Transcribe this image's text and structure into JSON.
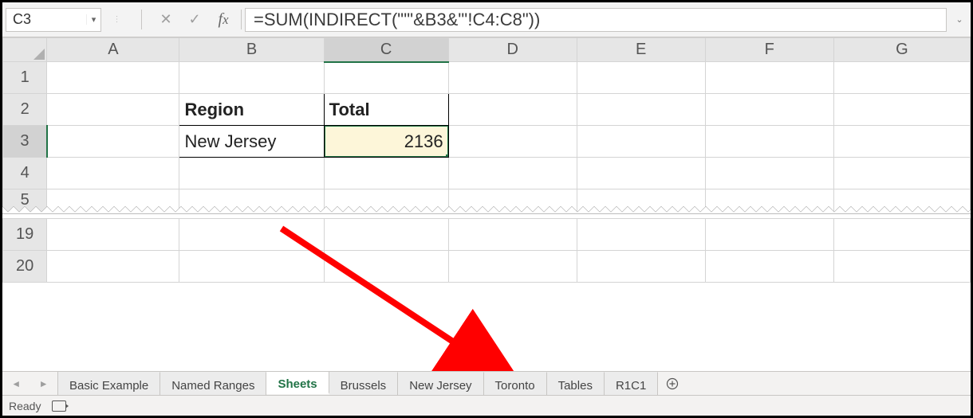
{
  "name_box": {
    "value": "C3"
  },
  "formula_bar": {
    "cancel_tip": "Cancel",
    "enter_tip": "Enter",
    "fx_tip": "Insert Function",
    "formula": "=SUM(INDIRECT(\"'\"&B3&\"'!C4:C8\"))"
  },
  "columns": [
    "A",
    "B",
    "C",
    "D",
    "E",
    "F",
    "G"
  ],
  "rows_top": [
    "1",
    "2",
    "3",
    "4",
    "5"
  ],
  "rows_bottom": [
    "19",
    "20"
  ],
  "cells": {
    "B2": "Region",
    "C2": "Total",
    "B3": "New Jersey",
    "C3": "2136"
  },
  "active_cell": "C3",
  "sheets": [
    {
      "name": "Basic Example",
      "active": false
    },
    {
      "name": "Named Ranges",
      "active": false
    },
    {
      "name": "Sheets",
      "active": true
    },
    {
      "name": "Brussels",
      "active": false
    },
    {
      "name": "New Jersey",
      "active": false
    },
    {
      "name": "Toronto",
      "active": false
    },
    {
      "name": "Tables",
      "active": false
    },
    {
      "name": "R1C1",
      "active": false
    }
  ],
  "status": {
    "state": "Ready"
  }
}
